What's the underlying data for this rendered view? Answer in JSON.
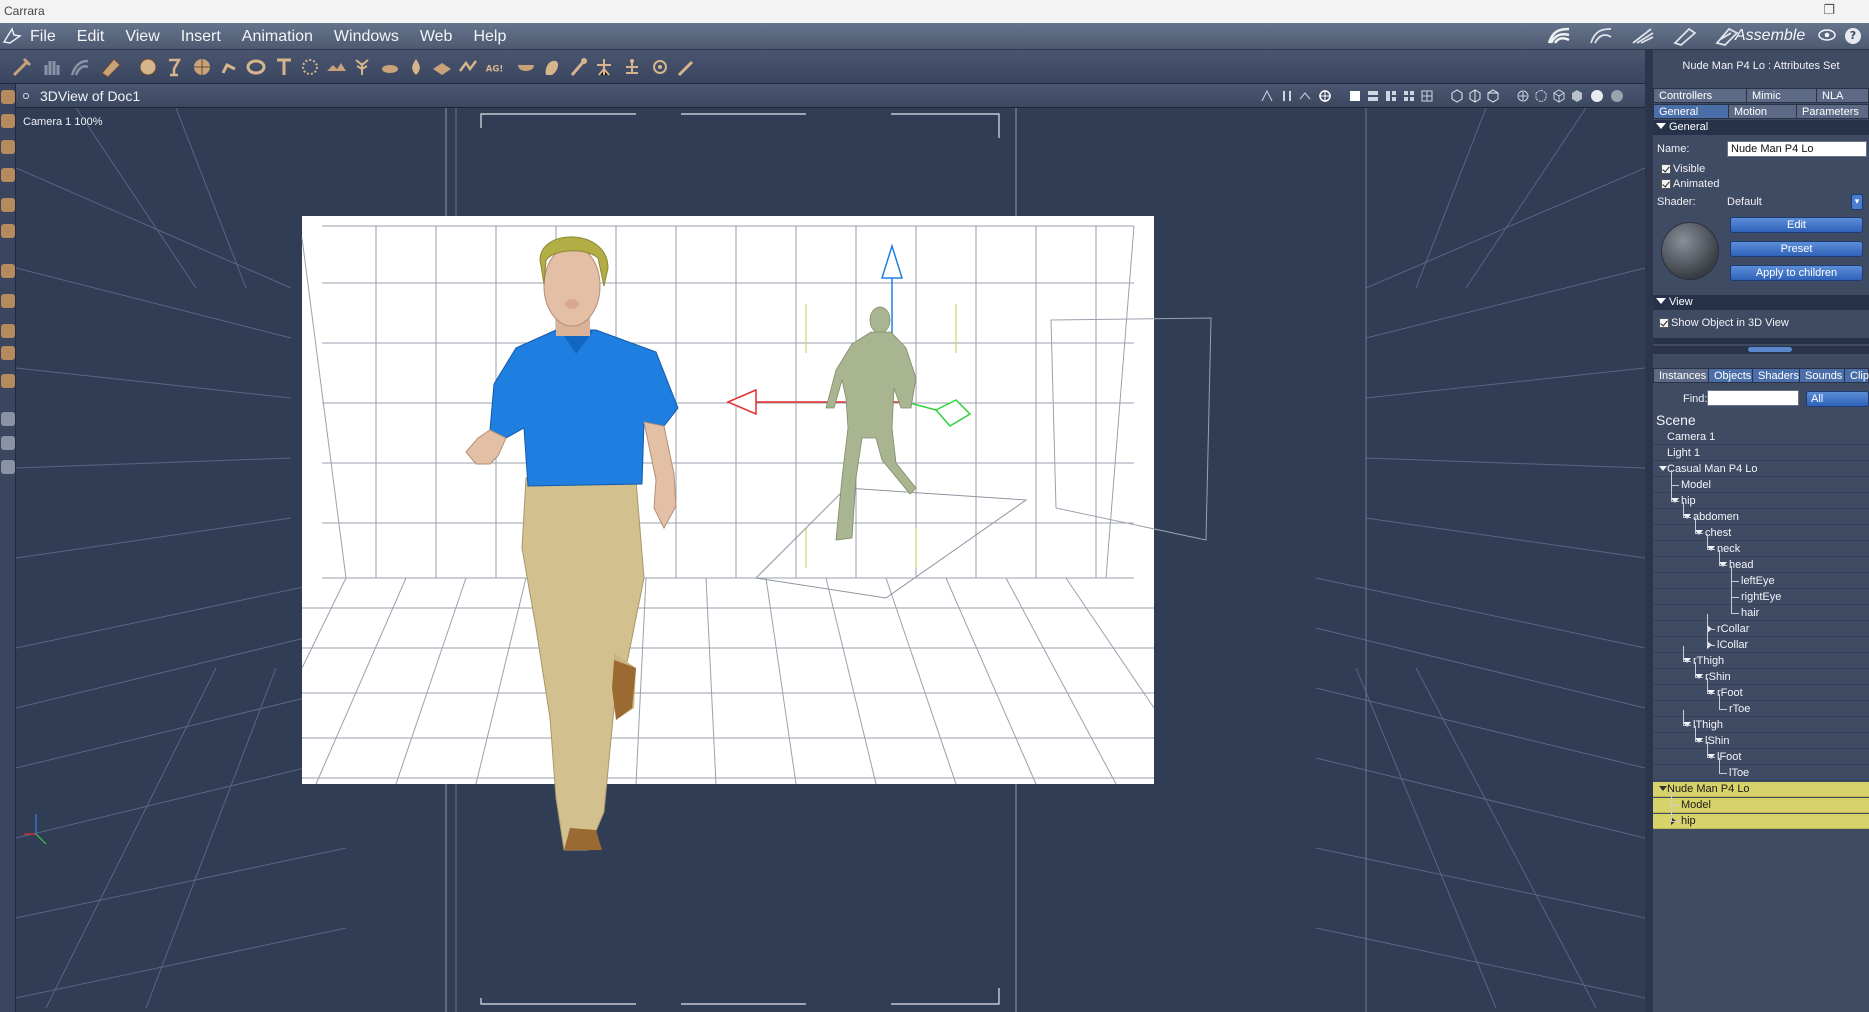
{
  "window": {
    "title": "Carrara"
  },
  "menu": {
    "items": [
      "File",
      "Edit",
      "View",
      "Insert",
      "Animation",
      "Windows",
      "Web",
      "Help"
    ],
    "room_label": "Assemble"
  },
  "toolbar": {
    "icons": [
      "select-tool-icon",
      "hand-tool-icon",
      "rotate-tool-icon",
      "camera-tool-icon",
      "sphere-icon",
      "cone-icon",
      "grid-icon",
      "figure-icon",
      "torus-icon",
      "text-icon",
      "particles-icon",
      "terrain-icon",
      "plant-icon",
      "cloud-icon",
      "fire-icon",
      "ocean-icon",
      "spline-icon",
      "3d-text-icon",
      "bowl-icon",
      "hand-icon",
      "bone-icon",
      "skeleton-icon",
      "cluster-icon",
      "light-icon",
      "wand-icon"
    ]
  },
  "viewport": {
    "title": "3DView of Doc1",
    "camera_label": "Camera 1 100%"
  },
  "panel": {
    "title": "Nude Man P4 Lo : Attributes Set",
    "tabs_row1": [
      "Controllers",
      "Mimic",
      "NLA"
    ],
    "tabs_row2": [
      "General",
      "Motion",
      "Parameters"
    ],
    "general_section": "General",
    "name_label": "Name:",
    "name_value": "Nude Man P4 Lo",
    "visible_label": "Visible",
    "animated_label": "Animated",
    "shader_label": "Shader:",
    "shader_value": "Default",
    "edit_button": "Edit",
    "preset_button": "Preset",
    "apply_button": "Apply to children",
    "view_section": "View",
    "show_object_label": "Show Object in 3D View",
    "browser_tabs": [
      "Instances",
      "Objects",
      "Shaders",
      "Sounds",
      "Clip"
    ],
    "find_label": "Find:",
    "find_value": "",
    "filter_value": "All",
    "scene_label": "Scene"
  },
  "tree": [
    {
      "label": "Camera 1",
      "depth": 0,
      "toggle": "none",
      "highlight": false
    },
    {
      "label": "Light 1",
      "depth": 0,
      "toggle": "none",
      "highlight": false
    },
    {
      "label": "Casual Man P4 Lo",
      "depth": 0,
      "toggle": "open",
      "highlight": false
    },
    {
      "label": "Model",
      "depth": 1,
      "toggle": "none",
      "highlight": false
    },
    {
      "label": "hip",
      "depth": 1,
      "toggle": "open",
      "highlight": false
    },
    {
      "label": "abdomen",
      "depth": 2,
      "toggle": "open",
      "highlight": false
    },
    {
      "label": "chest",
      "depth": 3,
      "toggle": "open",
      "highlight": false
    },
    {
      "label": "neck",
      "depth": 4,
      "toggle": "open",
      "highlight": false
    },
    {
      "label": "head",
      "depth": 5,
      "toggle": "open",
      "highlight": false
    },
    {
      "label": "leftEye",
      "depth": 6,
      "toggle": "none",
      "highlight": false
    },
    {
      "label": "rightEye",
      "depth": 6,
      "toggle": "none",
      "highlight": false
    },
    {
      "label": "hair",
      "depth": 6,
      "toggle": "none",
      "highlight": false
    },
    {
      "label": "rCollar",
      "depth": 4,
      "toggle": "closed",
      "highlight": false
    },
    {
      "label": "lCollar",
      "depth": 4,
      "toggle": "closed",
      "highlight": false
    },
    {
      "label": "rThigh",
      "depth": 2,
      "toggle": "open",
      "highlight": false
    },
    {
      "label": "rShin",
      "depth": 3,
      "toggle": "open",
      "highlight": false
    },
    {
      "label": "rFoot",
      "depth": 4,
      "toggle": "open",
      "highlight": false
    },
    {
      "label": "rToe",
      "depth": 5,
      "toggle": "none",
      "highlight": false
    },
    {
      "label": "lThigh",
      "depth": 2,
      "toggle": "open",
      "highlight": false
    },
    {
      "label": "lShin",
      "depth": 3,
      "toggle": "open",
      "highlight": false
    },
    {
      "label": "lFoot",
      "depth": 4,
      "toggle": "open",
      "highlight": false
    },
    {
      "label": "lToe",
      "depth": 5,
      "toggle": "none",
      "highlight": false
    },
    {
      "label": "Nude Man P4 Lo",
      "depth": 0,
      "toggle": "open",
      "highlight": true
    },
    {
      "label": "Model",
      "depth": 1,
      "toggle": "none",
      "highlight": true
    },
    {
      "label": "hip",
      "depth": 1,
      "toggle": "closed",
      "highlight": true
    }
  ],
  "colors": {
    "shirt": "#1f7fe0",
    "pants": "#d2c08e",
    "skin": "#e3bfa6",
    "hair": "#b3ad45",
    "nude_figure": "#a8b590",
    "selection_highlight": "#d8d26a",
    "button_blue": "#3f74c8"
  }
}
